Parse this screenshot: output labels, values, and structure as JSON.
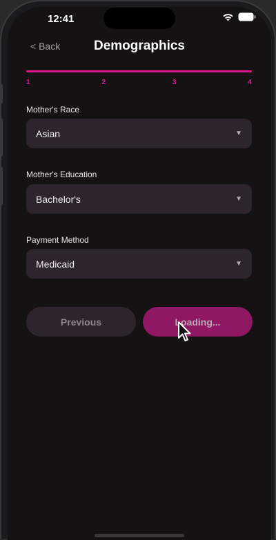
{
  "status_bar": {
    "time": "12:41",
    "icons": [
      "wifi-icon",
      "battery-icon"
    ]
  },
  "header": {
    "back_label": "< Back",
    "title": "Demographics"
  },
  "progress": {
    "current_step": 4,
    "total_steps": 4,
    "steps": [
      "1",
      "2",
      "3",
      "4"
    ],
    "accent_color": "#e0178c"
  },
  "form": {
    "fields": [
      {
        "label": "Mother's Race",
        "value": "Asian"
      },
      {
        "label": "Mother's Education",
        "value": "Bachelor's"
      },
      {
        "label": "Payment Method",
        "value": "Medicaid"
      }
    ],
    "caret_glyph": "▼"
  },
  "actions": {
    "previous_label": "Previous",
    "next_label": "Loading..."
  },
  "colors": {
    "background": "#151214",
    "field_background": "#2e242b",
    "primary_button": "#8f1763"
  }
}
